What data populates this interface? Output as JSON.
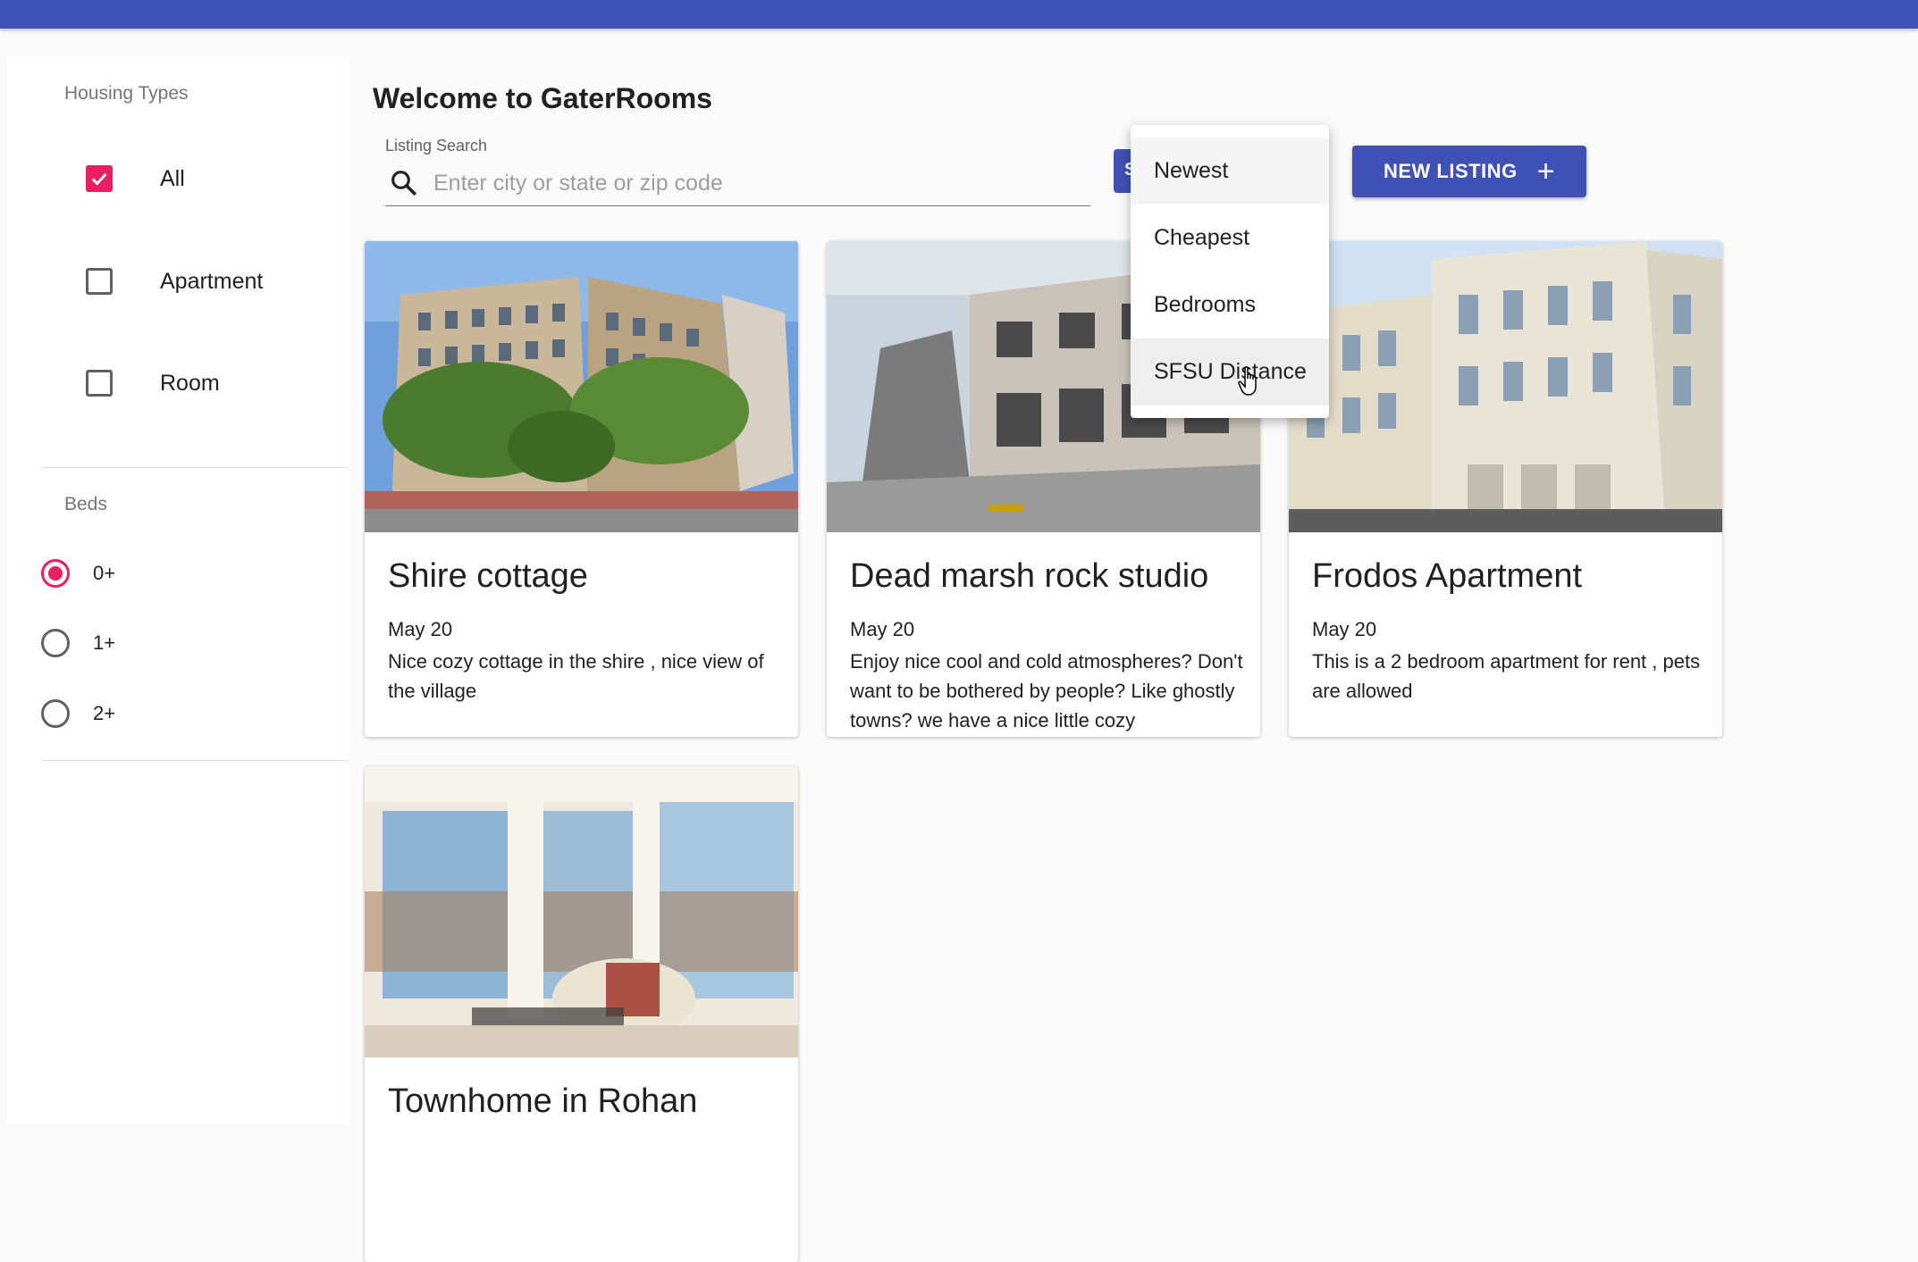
{
  "app": {
    "title": "Welcome to GaterRooms",
    "brand_color": "#3f51b5",
    "accent_color": "#e91e63"
  },
  "sidebar": {
    "housing_types_title": "Housing Types",
    "housing_types": [
      {
        "label": "All",
        "checked": true
      },
      {
        "label": "Apartment",
        "checked": false
      },
      {
        "label": "Room",
        "checked": false
      }
    ],
    "beds_title": "Beds",
    "beds": [
      {
        "label": "0+",
        "selected": true
      },
      {
        "label": "1+",
        "selected": false
      },
      {
        "label": "2+",
        "selected": false
      }
    ]
  },
  "search": {
    "label": "Listing Search",
    "placeholder": "Enter city or state or zip code",
    "value": ""
  },
  "toolbar": {
    "sort_label": "S",
    "new_listing_label": "NEW LISTING",
    "new_listing_icon": "plus-icon"
  },
  "sort_menu": {
    "items": [
      {
        "label": "Newest",
        "state": "selected"
      },
      {
        "label": "Cheapest",
        "state": ""
      },
      {
        "label": "Bedrooms",
        "state": ""
      },
      {
        "label": "SFSU Distance",
        "state": "hover"
      }
    ]
  },
  "listings": [
    {
      "title": "Shire cottage",
      "date": "May 20",
      "description": "Nice cozy cottage in the shire , nice view of the village"
    },
    {
      "title": "Dead marsh rock studio",
      "date": "May 20",
      "description": "Enjoy nice cool and cold atmospheres? Don't want to be bothered by people? Like ghostly towns? we have a nice little cozy"
    },
    {
      "title": "Frodos Apartment",
      "date": "May 20",
      "description": "This is a 2 bedroom apartment for rent , pets are allowed"
    },
    {
      "title": "Townhome in Rohan",
      "date": "",
      "description": ""
    }
  ]
}
